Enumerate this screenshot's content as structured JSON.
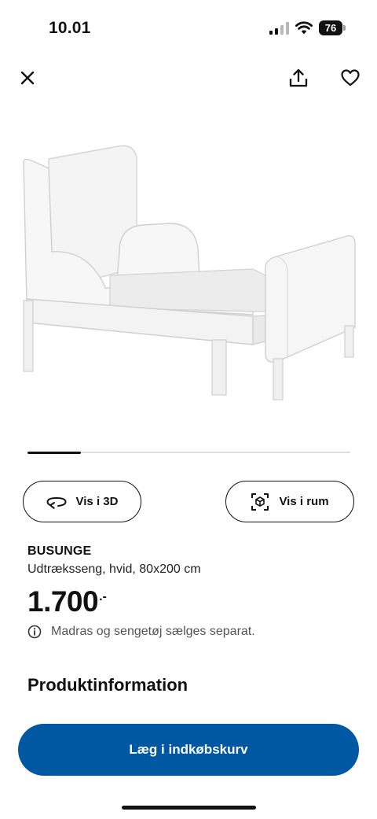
{
  "status_bar": {
    "time": "10.01",
    "battery_level": "76",
    "icons": [
      "cellular-signal-icon",
      "wifi-icon",
      "battery-icon"
    ]
  },
  "header": {
    "icons": [
      "close-icon",
      "share-icon",
      "heart-icon"
    ]
  },
  "gallery": {
    "image_subject": "white extendable children's bed",
    "progress": 0.165
  },
  "view_buttons": {
    "view_3d_label": "Vis i 3D",
    "view_in_room_label": "Vis i rum"
  },
  "product": {
    "name": "BUSUNGE",
    "description": "Udtræksseng, hvid, 80x200 cm",
    "price": "1.700",
    "price_suffix": ".-",
    "notice": "Madras og sengetøj sælges separat."
  },
  "sections": {
    "product_info_heading": "Produktinformation"
  },
  "cta": {
    "add_to_cart_label": "Læg i indkøbskurv",
    "color": "#0058a3"
  }
}
